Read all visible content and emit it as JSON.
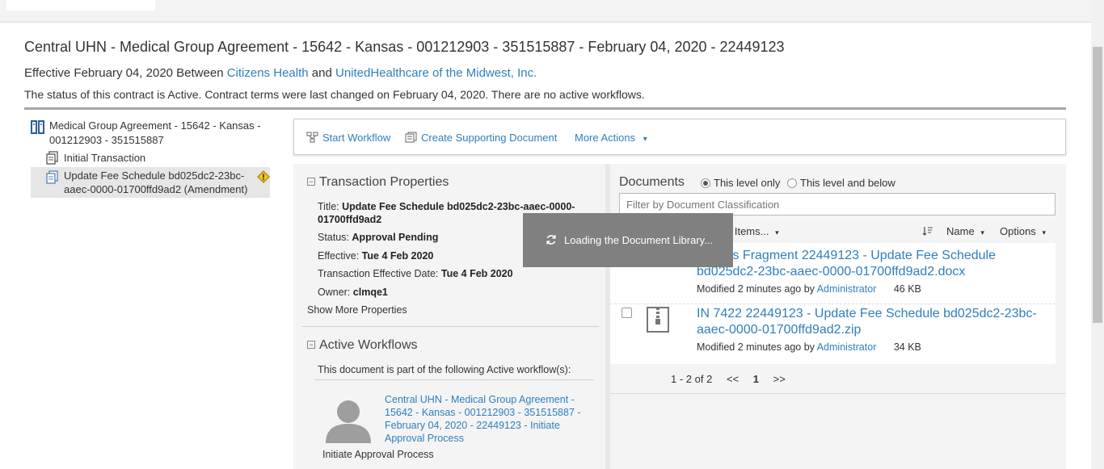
{
  "header": {
    "title": "Central UHN - Medical Group Agreement - 15642 - Kansas - 001212903 - 351515887 - February 04, 2020 - 22449123",
    "effective_prefix": "Effective February 04, 2020 Between",
    "party1": "Citizens Health",
    "and_text": "and",
    "party2": "UnitedHealthcare of the Midwest, Inc.",
    "status_text": "The status of this contract is Active. Contract terms were last changed on February 04, 2020. There are no active workflows."
  },
  "tree": {
    "root_label": "Medical Group Agreement - 15642 - Kansas - 001212903 - 351515887",
    "child1_label": "Initial Transaction",
    "child2_label": "Update Fee Schedule bd025dc2-23bc-aaec-0000-01700ffd9ad2 (Amendment)"
  },
  "actions": {
    "start_workflow": "Start Workflow",
    "create_doc": "Create Supporting Document",
    "more_actions": "More Actions",
    "more_caret": "▾"
  },
  "transaction": {
    "heading": "Transaction Properties",
    "toggle": "−",
    "title_label": "Title:",
    "title_value": "Update Fee Schedule bd025dc2-23bc-aaec-0000-01700ffd9ad2",
    "status_label": "Status:",
    "status_value": "Approval Pending",
    "effective_label": "Effective:",
    "effective_value": "Tue 4 Feb 2020",
    "ted_label": "Transaction Effective Date:",
    "ted_value": "Tue 4 Feb 2020",
    "owner_label": "Owner:",
    "owner_value": "clmqe1",
    "show_more": "Show More Properties"
  },
  "workflows": {
    "heading": "Active Workflows",
    "toggle": "−",
    "intro": "This document is part of the following Active workflow(s):",
    "link": "Central UHN - Medical Group Agreement - 15642 - Kansas - 001212903 - 351515887 - February 04, 2020 - 22449123 - Initiate Approval Process",
    "step": "Initiate Approval Process"
  },
  "documents": {
    "heading": "Documents",
    "radio1": "This level only",
    "radio2": "This level and below",
    "filter_placeholder": "Filter by Document Classification",
    "selected_items": "d Items...",
    "sort_label": "Name",
    "options_label": "Options",
    "caret": "▾",
    "items": [
      {
        "name": "dments Fragment 22449123 - Update Fee Schedule bd025dc2-23bc-aaec-0000-01700ffd9ad2.docx",
        "modified": "Modified 2 minutes ago by",
        "by": "Administrator",
        "size": "46 KB"
      },
      {
        "name": "IN 7422 22449123 - Update Fee Schedule bd025dc2-23bc-aaec-0000-01700ffd9ad2.zip",
        "modified": "Modified 2 minutes ago by",
        "by": "Administrator",
        "size": "34 KB"
      }
    ],
    "pager": {
      "range": "1 - 2 of 2",
      "prev": "<<",
      "page": "1",
      "next": ">>"
    }
  },
  "loading": {
    "text": "Loading the Document Library..."
  },
  "colors": {
    "link": "#2f7fbf",
    "overlay": "#808080",
    "panel": "#f4f4f4"
  }
}
